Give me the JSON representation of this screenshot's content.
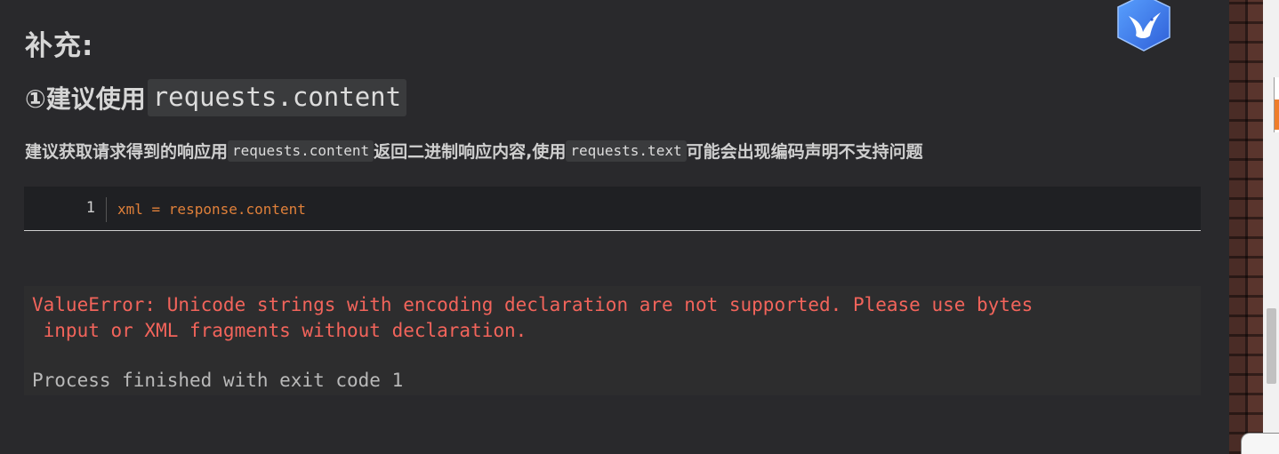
{
  "section": {
    "title": "补充:"
  },
  "subsection": {
    "prefix": "①建议使用",
    "code": "requests.content"
  },
  "paragraph": {
    "part1": "建议获取请求得到的响应用",
    "code1": "requests.content",
    "part2": "返回二进制响应内容,使用",
    "code2": "requests.text",
    "part3": "可能会出现编码声明不支持问题"
  },
  "code_block": {
    "line_number": "1",
    "code": "xml = response.content"
  },
  "console": {
    "error_line1": "ValueError: Unicode strings with encoding declaration are not supported. Please use bytes",
    "error_line2": " input or XML fragments without declaration.",
    "process_line": "Process finished with exit code 1"
  },
  "icons": {
    "logo": "bird-logo-icon"
  },
  "colors": {
    "background": "#29292c",
    "code_keyword": "#e0803a",
    "error_text": "#f2645b",
    "logo_blue": "#3f7ff0"
  }
}
